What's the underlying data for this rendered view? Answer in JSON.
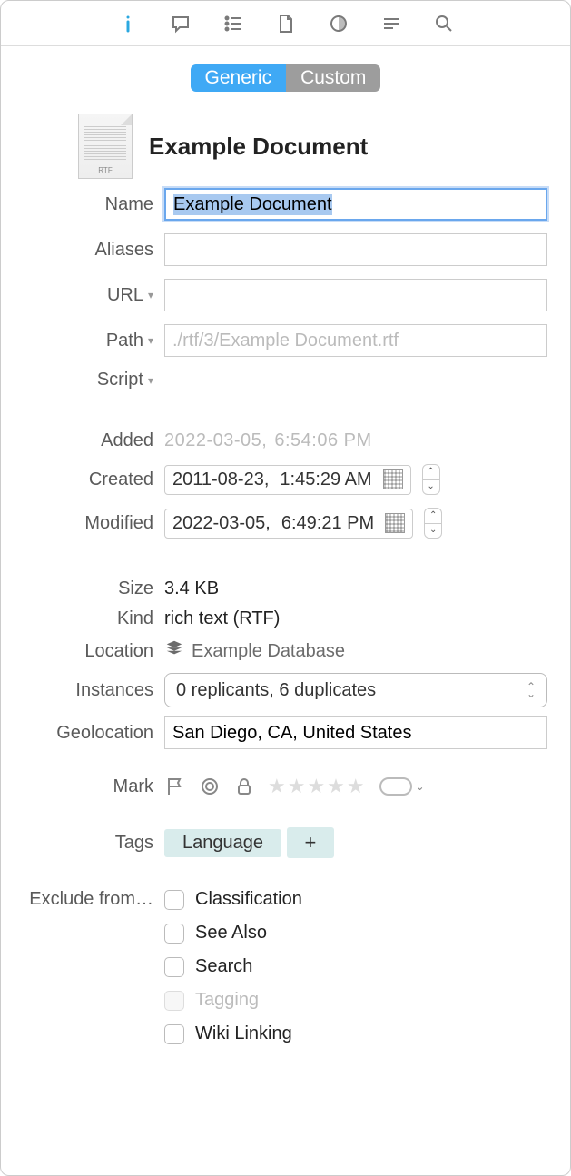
{
  "toolbar": {
    "icons": [
      "info",
      "comment",
      "list",
      "document",
      "dot",
      "lines",
      "search"
    ]
  },
  "tabs": {
    "generic": "Generic",
    "custom": "Custom"
  },
  "header": {
    "title": "Example Document",
    "file_type_badge": "RTF"
  },
  "fields": {
    "name": {
      "label": "Name",
      "value": "Example Document"
    },
    "aliases": {
      "label": "Aliases",
      "value": ""
    },
    "url": {
      "label": "URL",
      "value": ""
    },
    "path": {
      "label": "Path",
      "value": "./rtf/3/Example Document.rtf"
    },
    "script": {
      "label": "Script"
    },
    "added": {
      "label": "Added",
      "date": "2022-03-05,",
      "time": "6:54:06 PM"
    },
    "created": {
      "label": "Created",
      "date": "2011-08-23,",
      "time": "1:45:29 AM"
    },
    "modified": {
      "label": "Modified",
      "date": "2022-03-05,",
      "time": "6:49:21 PM"
    },
    "size": {
      "label": "Size",
      "value": "3.4 KB"
    },
    "kind": {
      "label": "Kind",
      "value": "rich text (RTF)"
    },
    "location": {
      "label": "Location",
      "value": "Example Database"
    },
    "instances": {
      "label": "Instances",
      "value": "0 replicants, 6 duplicates"
    },
    "geolocation": {
      "label": "Geolocation",
      "value": "San Diego, CA, United States"
    },
    "mark": {
      "label": "Mark"
    },
    "tags": {
      "label": "Tags",
      "items": [
        "Language"
      ],
      "add": "+"
    },
    "exclude": {
      "label": "Exclude from…",
      "options": [
        {
          "label": "Classification",
          "disabled": false
        },
        {
          "label": "See Also",
          "disabled": false
        },
        {
          "label": "Search",
          "disabled": false
        },
        {
          "label": "Tagging",
          "disabled": true
        },
        {
          "label": "Wiki Linking",
          "disabled": false
        }
      ]
    }
  }
}
